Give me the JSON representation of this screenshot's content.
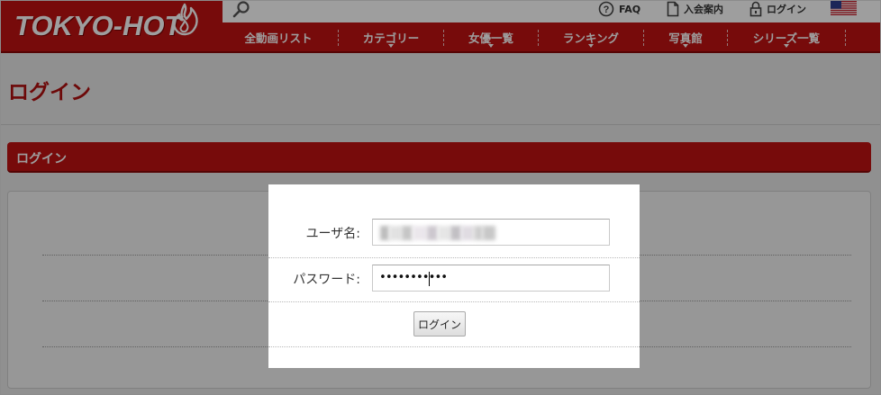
{
  "brand": {
    "name": "TOKYO-HOT",
    "color": "#c01313"
  },
  "utility": {
    "faq_label": "FAQ",
    "join_label": "入会案内",
    "login_label": "ログイン"
  },
  "nav": {
    "items": [
      {
        "label": "全動画リスト",
        "has_dropdown": false
      },
      {
        "label": "カテゴリー",
        "has_dropdown": true
      },
      {
        "label": "女優一覧",
        "has_dropdown": true
      },
      {
        "label": "ランキング",
        "has_dropdown": true
      },
      {
        "label": "写真館",
        "has_dropdown": true
      },
      {
        "label": "シリーズ一覧",
        "has_dropdown": true
      }
    ]
  },
  "page": {
    "title": "ログイン",
    "section_title": "ログイン"
  },
  "login_form": {
    "username_label": "ユーザ名:",
    "password_label": "パスワード:",
    "password_masked": "•••••••••••",
    "submit_label": "ログイン"
  },
  "icons": {
    "search": "search-icon",
    "faq": "help-circle-icon",
    "join": "document-icon",
    "login": "lock-icon",
    "language": "us-flag-icon"
  }
}
